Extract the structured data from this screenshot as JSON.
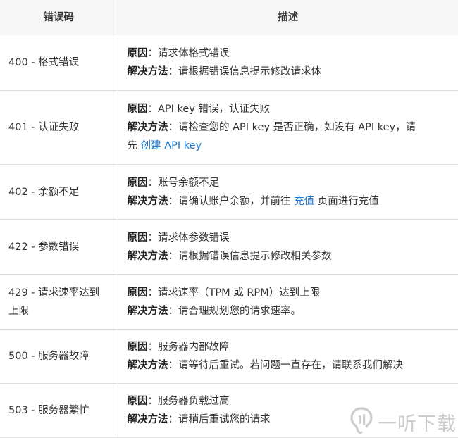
{
  "header": {
    "code_col": "错误码",
    "desc_col": "描述"
  },
  "rows": [
    {
      "code": "400 - 格式错误",
      "cause_label": "原因",
      "cause": "：请求体格式错误",
      "solution_label": "解决方法",
      "solution": "：请根据错误信息提示修改请求体"
    },
    {
      "code": "401 - 认证失败",
      "cause_label": "原因",
      "cause": "：API key 错误，认证失败",
      "solution_label": "解决方法",
      "solution": "：请检查您的 API key 是否正确，如没有 API key，请",
      "solution_line2_prefix": "先 ",
      "solution_link": "创建 API key"
    },
    {
      "code": "402 - 余额不足",
      "cause_label": "原因",
      "cause": "：账号余额不足",
      "solution_label": "解决方法",
      "solution_pre": "：请确认账户余额，并前往 ",
      "solution_link": "充值",
      "solution_post": " 页面进行充值"
    },
    {
      "code": "422 - 参数错误",
      "cause_label": "原因",
      "cause": "：请求体参数错误",
      "solution_label": "解决方法",
      "solution": "：请根据错误信息提示修改相关参数"
    },
    {
      "code_line1": "429 - 请求速率达到",
      "code_line2": "上限",
      "cause_label": "原因",
      "cause": "：请求速率（TPM 或 RPM）达到上限",
      "solution_label": "解决方法",
      "solution": "：请合理规划您的请求速率。"
    },
    {
      "code": "500 - 服务器故障",
      "cause_label": "原因",
      "cause": "：服务器内部故障",
      "solution_label": "解决方法",
      "solution": "：请等待后重试。若问题一直存在，请联系我们解决"
    },
    {
      "code": "503 - 服务器繁忙",
      "cause_label": "原因",
      "cause": "：服务器负载过高",
      "solution_label": "解决方法",
      "solution": "：请稍后重试您的请求"
    }
  ],
  "watermark": {
    "icon": "ear-logo-icon",
    "text": "一听下载"
  }
}
